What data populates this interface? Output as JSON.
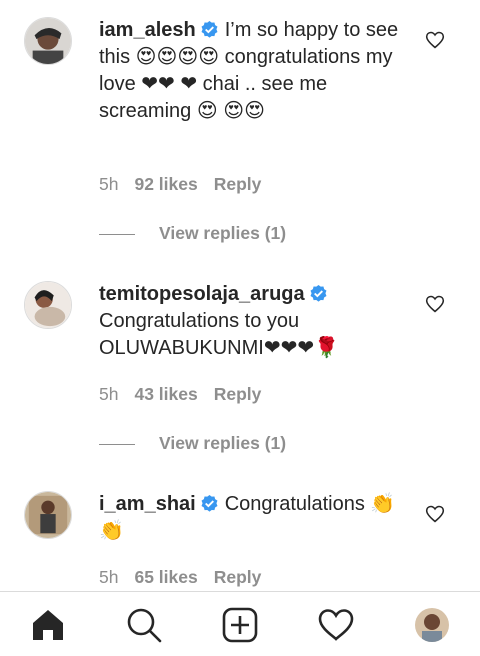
{
  "comments": [
    {
      "username": "iam_alesh",
      "text": "I’m so happy to see this 😍😍😍😍 congratulations my love ❤❤ ❤ chai .. see me screaming 😍 😍😍",
      "time": "5h",
      "likes": "92 likes",
      "reply": "Reply",
      "view_replies": "View replies (1)"
    },
    {
      "username": "temitopesolaja_aruga",
      "text": "Congratulations to you OLUWABUKUNMI❤❤❤🌹",
      "time": "5h",
      "likes": "43 likes",
      "reply": "Reply",
      "view_replies": "View replies (1)"
    },
    {
      "username": "i_am_shai",
      "text": "Congratulations 👏👏",
      "time": "5h",
      "likes": "65 likes",
      "reply": "Reply"
    }
  ],
  "icons": {
    "verified": "verified-badge-icon",
    "like": "heart-outline-icon",
    "nav": [
      "home-icon",
      "search-icon",
      "new-post-icon",
      "activity-heart-icon",
      "profile-avatar"
    ]
  },
  "colors": {
    "verified": "#3897f0",
    "heart_emoji": "#e0245e",
    "muted_text": "#8e8e8e"
  }
}
